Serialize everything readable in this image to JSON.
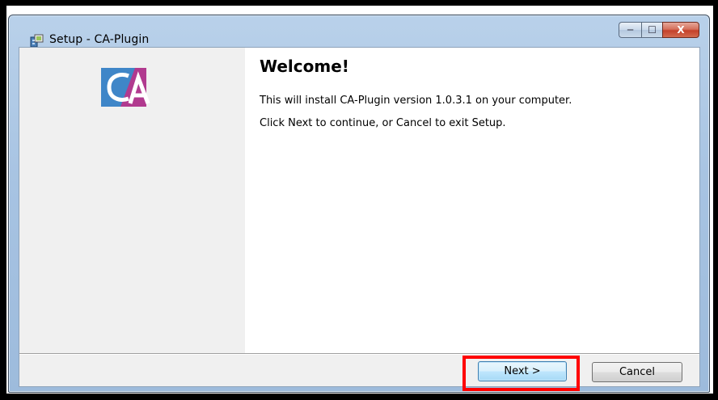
{
  "window": {
    "title": "Setup - CA-Plugin",
    "controls": {
      "minimize": "─",
      "maximize": "☐",
      "close": "X"
    }
  },
  "sidebar": {
    "logo_alt": "CA"
  },
  "main": {
    "heading": "Welcome!",
    "line1": "This will install CA-Plugin version 1.0.3.1 on your computer.",
    "line2": "Click Next to continue, or Cancel to exit Setup."
  },
  "footer": {
    "next_label": "Next >",
    "cancel_label": "Cancel"
  },
  "colors": {
    "logo_blue": "#3f86c8",
    "logo_magenta": "#b13a8f",
    "highlight": "#ff0000"
  }
}
